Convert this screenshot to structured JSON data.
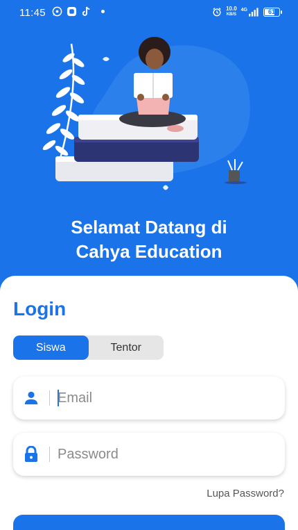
{
  "status_bar": {
    "time": "11:45",
    "net_speed_value": "10.0",
    "net_speed_unit": "KB/S",
    "network": "4G",
    "battery": "61"
  },
  "welcome": {
    "line1": "Selamat Datang di",
    "line2": "Cahya Education"
  },
  "login": {
    "title": "Login",
    "tabs": [
      {
        "label": "Siswa",
        "active": true
      },
      {
        "label": "Tentor",
        "active": false
      }
    ],
    "email_placeholder": "Email",
    "password_placeholder": "Password",
    "forgot_password": "Lupa Password?"
  },
  "colors": {
    "primary": "#1a73e8",
    "background": "#1a73e8",
    "card": "#ffffff",
    "tab_inactive": "#e6e6e6"
  }
}
